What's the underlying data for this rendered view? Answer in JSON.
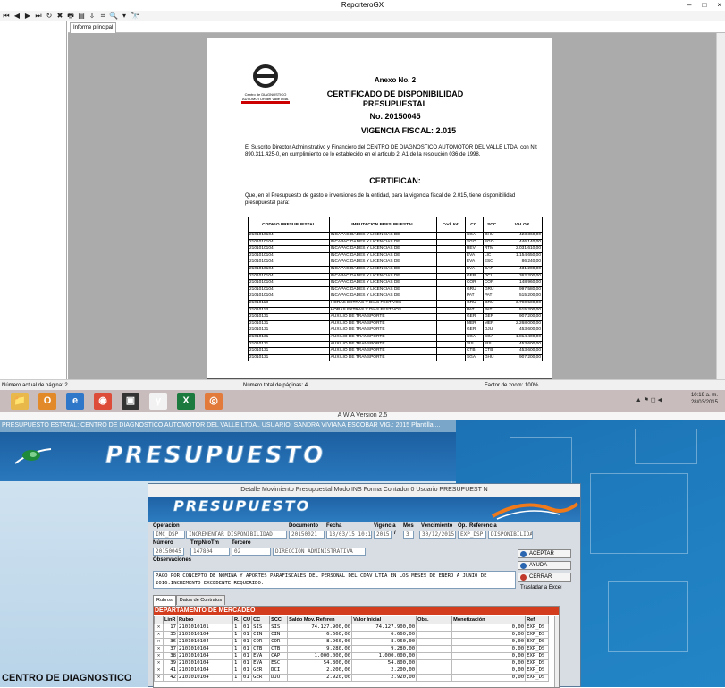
{
  "reporter": {
    "title": "ReporteroGX",
    "window_controls": [
      "–",
      "□",
      "×"
    ],
    "toolbar_icons": [
      "first-page-icon",
      "prev-page-icon",
      "next-page-icon",
      "last-page-icon",
      "refresh-icon",
      "close-icon",
      "print-icon",
      "export-icon",
      "export-pdf-icon",
      "page-setup-icon",
      "zoom-icon",
      "dropdown-icon",
      "find-icon"
    ],
    "toolbar_glyphs": [
      "⏮",
      "◀",
      "▶",
      "⏭",
      "↻",
      "✖",
      "🖶",
      "▤",
      "⇩",
      "⌗",
      "🔍",
      "▾",
      "🔭"
    ],
    "tab": "Informe principal",
    "status": {
      "current_page": "Número actual de página: 2",
      "total_pages": "Número total de páginas: 4",
      "zoom": "Factor de zoom: 100%"
    },
    "document": {
      "logo_text_1": "Centro de DIAGNOSTICO",
      "logo_text_2": "AUTOMOTOR del Valle Ltda.",
      "annex": "Anexo No. 2",
      "certificate_title": "CERTIFICADO DE DISPONIBILIDAD PRESUPUESTAL",
      "certificate_no": "No. 20150045",
      "fiscal": "VIGENCIA FISCAL:  2.015",
      "intro": "El Suscrito Director Administrativo y Financiero del CENTRO DE DIAGNOSTICO AUTOMOTOR DEL VALLE LTDA. con Nit 890.311.425-0, en cumplimiento de lo establecido en el articulo 2, A1 de la resolución 036 de 1998.",
      "certifican": "CERTIFICAN:",
      "que": "Que, en el Presupuesto de gasto e inversiones de la entidad, para la vigencia fiscal del 2.015, tiene disponibilidad presupuestal para:",
      "table_headers": [
        "CODIGO PRESUPUESTAL",
        "IMPUTACION PRESUPUESTAL",
        "Cod. Int.",
        "CC.",
        "SCC.",
        "VALOR"
      ],
      "table_rows": [
        [
          "2101010104",
          "INCAPACIDADES Y LICENCIAS DE",
          "",
          "SGA",
          "GHU",
          "423.360,00"
        ],
        [
          "2101010104",
          "INCAPACIDADES Y LICENCIAS DE",
          "",
          "SGO",
          "SGO",
          "446.140,00"
        ],
        [
          "2101010104",
          "INCAPACIDADES Y LICENCIAS DE",
          "",
          "REV",
          "RTM",
          "2.031.610,00"
        ],
        [
          "2101010104",
          "INCAPACIDADES Y LICENCIAS DE",
          "",
          "EVA",
          "LIC",
          "1.154.650,00"
        ],
        [
          "2101010104",
          "INCAPACIDADES Y LICENCIAS DE",
          "",
          "EVA",
          "ESC",
          "86.240,00"
        ],
        [
          "2101010104",
          "INCAPACIDADES Y LICENCIAS DE",
          "",
          "EVA",
          "CAP",
          "431.200,00"
        ],
        [
          "2101010104",
          "INCAPACIDADES Y LICENCIAS DE",
          "",
          "GER",
          "DCI",
          "362.200,00"
        ],
        [
          "2101010104",
          "INCAPACIDADES Y LICENCIAS DE",
          "",
          "COR",
          "COR",
          "148.960,00"
        ],
        [
          "2101010104",
          "INCAPACIDADES Y LICENCIAS DE",
          "",
          "GRU",
          "GRU",
          "997.580,00"
        ],
        [
          "2101010104",
          "INCAPACIDADES Y LICENCIAS DE",
          "",
          "PAT",
          "PAT",
          "515.200,00"
        ],
        [
          "21010113",
          "HORAS EXTRAS Y DIAS FESTIVOS",
          "",
          "GRU",
          "GRU",
          "3.790.500,00"
        ],
        [
          "21010113",
          "HORAS EXTRAS Y DIAS FESTIVOS",
          "",
          "PAT",
          "PAT",
          "515.200,00"
        ],
        [
          "21010131",
          "AUXILIO DE TRANSPORTE",
          "",
          "GER",
          "GER",
          "907.200,00"
        ],
        [
          "21010131",
          "AUXILIO DE TRANSPORTE",
          "",
          "MER",
          "MER",
          "2.268.000,00"
        ],
        [
          "21010131",
          "AUXILIO DE TRANSPORTE",
          "",
          "GER",
          "DJU",
          "453.600,00"
        ],
        [
          "21010131",
          "AUXILIO DE TRANSPORTE",
          "",
          "SGA",
          "SGA",
          "1.814.400,00"
        ],
        [
          "21010131",
          "AUXILIO DE TRANSPORTE",
          "",
          "SIS",
          "SIS",
          "453.600,00"
        ],
        [
          "21010131",
          "AUXILIO DE TRANSPORTE",
          "",
          "CTB",
          "CTB",
          "453.600,00"
        ],
        [
          "21010131",
          "AUXILIO DE TRANSPORTE",
          "",
          "SGA",
          "GHU",
          "907.200,00"
        ]
      ]
    }
  },
  "taskbar": {
    "time": "10:19 a. m.",
    "date": "28/03/2015",
    "icons": [
      "folder-icon",
      "outlook-icon",
      "ie-icon",
      "chrome-icon",
      "app-icon",
      "ypf-icon",
      "excel-icon",
      "reporter-icon"
    ],
    "glyphs": [
      "📁",
      "O",
      "e",
      "◉",
      "▣",
      "γ",
      "X",
      "◎"
    ],
    "tray": "▲ ⚑ ◻ ◀"
  },
  "awa": {
    "title": "A W A Version 2.5",
    "header": "PRESUPUESTO ESTATAL: CENTRO DE DIAGNOSTICO AUTOMOTOR DEL VALLE LTDA..  USUARIO: SANDRA VIVIANA ESCOBAR VIG.:     2015  Plantilla ...",
    "banner": "PRESUPUESTO",
    "side_label": "CENTRO DE DIAGNOSTICO",
    "dialog": {
      "title": "Detalle Movimiento Presupuestal Modo INS Forma  Contador 0 Usuario PRESUPUEST    N",
      "banner": "PRESUPUESTO",
      "labels": {
        "operacion": "Operacion",
        "documento": "Documento",
        "fecha": "Fecha",
        "vigencia": "Vigencia",
        "mes": "Mes",
        "vencimiento": "Vencimiento",
        "op": "Op.",
        "referencia": "Referencia",
        "numero": "Número",
        "tmp": "TmpNroTm",
        "tercero": "Tercero",
        "observaciones": "Observaciones"
      },
      "values": {
        "op_code": "IMC_DSP",
        "op_desc": "INCREMENTAR DISPONIBILIDAD",
        "documento": "20150021",
        "fecha": "13/03/15 10:14",
        "vigencia": "2015",
        "slash": "/",
        "mes": "3",
        "vencimiento": "30/12/2015",
        "op": "EXP_DSP",
        "referencia": "DISPONIBILIDAD",
        "numero": "20150045",
        "tmp": "147804",
        "tercero_code": "02",
        "tercero_desc": "DIRECCION  ADMINISTRATIVA",
        "observaciones": "PAGO POR CONCEPTO DE NÓMINA Y APORTES PARAFISCALES DEL PERSONAL DEL CDAV LTDA EN LOS MESES DE ENERO A JUNIO DE 2016.INCREMENTO EXCEDENTE REQUERIDO."
      },
      "buttons": {
        "accept": "ACEPTAR",
        "help": "AYUDA",
        "close": "CERRAR",
        "excel": "Trasladar a Excel"
      },
      "tabs": [
        "Rubros",
        "Datos de Contratos"
      ],
      "department": "DEPARTAMENTO DE MERCADEO",
      "grid_headers": [
        "",
        "LinR",
        "Rubro",
        "R.",
        "CU",
        "CC",
        "SCC",
        "Saldo Mov. Referen",
        "Valor Inicial",
        "Obs.",
        "Monetización",
        "Ref"
      ],
      "grid_rows": [
        [
          "✕",
          "17",
          "2101010101",
          "1",
          "01",
          "SIS",
          "SIS",
          "74.127.900,00",
          "74.127.900,00",
          "",
          "0,00",
          "EXP_DS"
        ],
        [
          "✕",
          "35",
          "2101010104",
          "1",
          "01",
          "CIN",
          "CIN",
          "6.660,00",
          "6.660,00",
          "",
          "0,00",
          "EXP_DS"
        ],
        [
          "✕",
          "36",
          "2101010104",
          "1",
          "01",
          "COR",
          "COR",
          "8.960,00",
          "8.960,00",
          "",
          "0,00",
          "EXP_DS"
        ],
        [
          "✕",
          "37",
          "2101010104",
          "1",
          "01",
          "CTB",
          "CTB",
          "9.280,00",
          "9.280,00",
          "",
          "0,00",
          "EXP_DS"
        ],
        [
          "✕",
          "38",
          "2101010104",
          "1",
          "01",
          "EVA",
          "CAP",
          "1.000.000,00",
          "1.000.000,00",
          "",
          "0,00",
          "EXP_DS"
        ],
        [
          "✕",
          "39",
          "2101010104",
          "1",
          "01",
          "EVA",
          "ESC",
          "54.800,00",
          "54.800,00",
          "",
          "0,00",
          "EXP_DS"
        ],
        [
          "✕",
          "41",
          "2101010104",
          "1",
          "01",
          "GER",
          "DCI",
          "2.200,00",
          "2.200,00",
          "",
          "0,00",
          "EXP_DS"
        ],
        [
          "✕",
          "42",
          "2101010104",
          "1",
          "01",
          "GER",
          "DJU",
          "2.920,00",
          "2.920,00",
          "",
          "0,00",
          "EXP_DS"
        ]
      ]
    }
  }
}
